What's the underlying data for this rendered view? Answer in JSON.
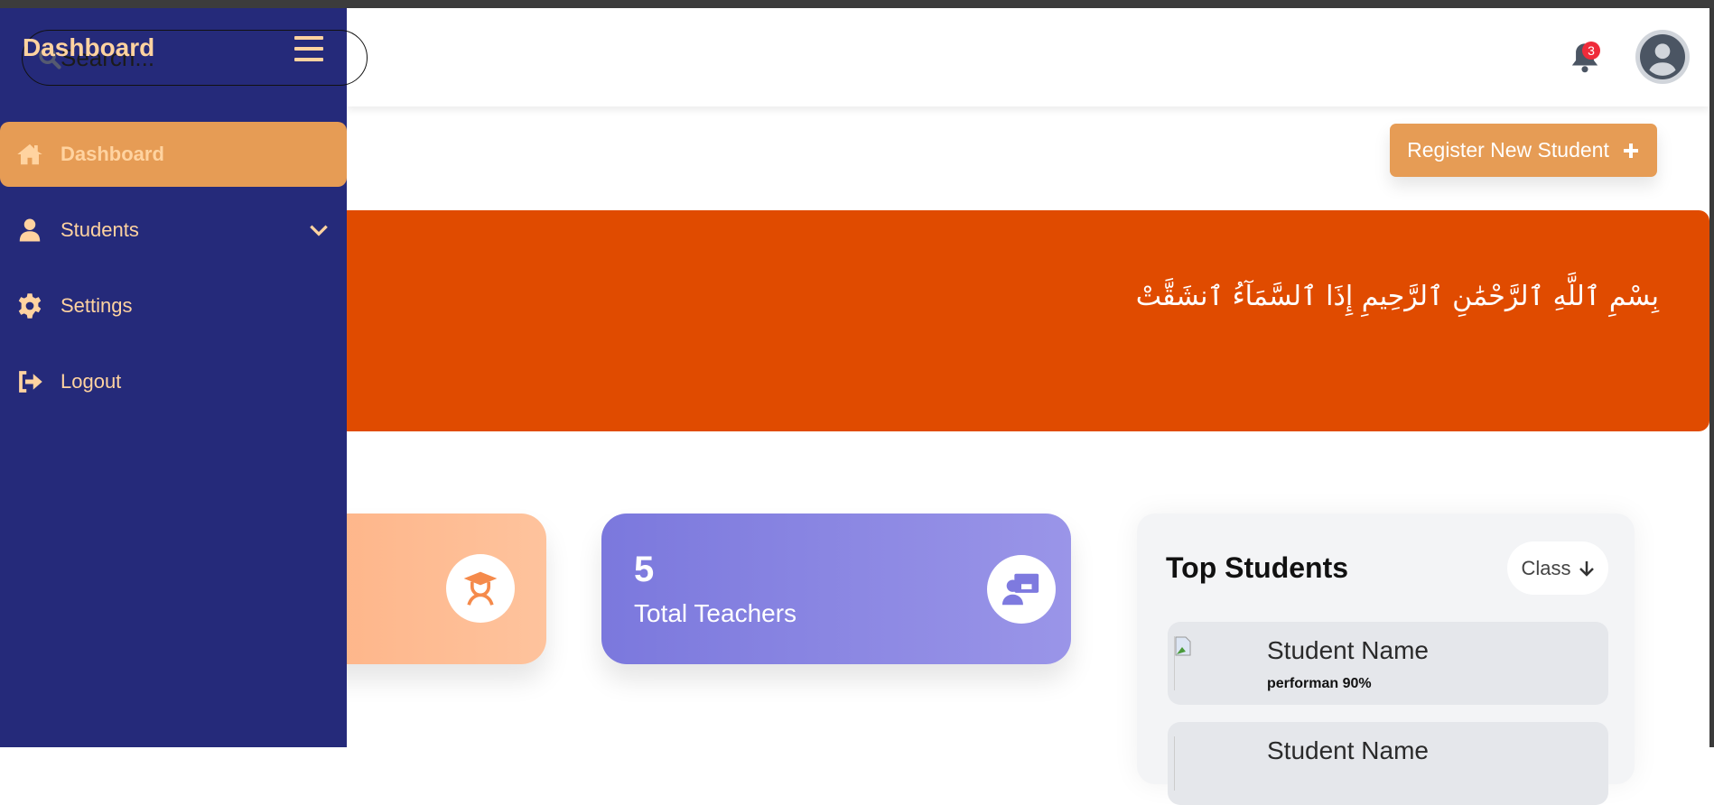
{
  "sidebar": {
    "brand": "Dashboard",
    "items": [
      {
        "label": "Dashboard",
        "icon": "home-icon",
        "active": true
      },
      {
        "label": "Students",
        "icon": "user-icon",
        "expandable": true
      },
      {
        "label": "Settings",
        "icon": "gear-icon"
      },
      {
        "label": "Logout",
        "icon": "logout-icon"
      }
    ]
  },
  "header": {
    "search_placeholder": "Search...",
    "notification_count": "3"
  },
  "main": {
    "register_label": "Register New Student",
    "banner_text": "بِسْمِ ٱللَّهِ ٱلرَّحْمَٰنِ ٱلرَّحِيمِ إِذَا ٱلسَّمَآءُ ٱنشَقَّتْ",
    "cards": [
      {
        "value": "",
        "label": "",
        "icon": "graduate-icon"
      },
      {
        "value": "5",
        "label": "Total Teachers",
        "icon": "teacher-icon"
      }
    ],
    "top_students": {
      "title": "Top Students",
      "filter_label": "Class",
      "students": [
        {
          "name": "Student Name",
          "performance": "performan 90%"
        },
        {
          "name": "Student Name"
        }
      ]
    }
  },
  "colors": {
    "sidebar": "#252a7a",
    "accent": "#e69c55",
    "sidebar_text": "#ffd3a0",
    "banner": "#e04b00",
    "badge": "#ef2b3a"
  }
}
